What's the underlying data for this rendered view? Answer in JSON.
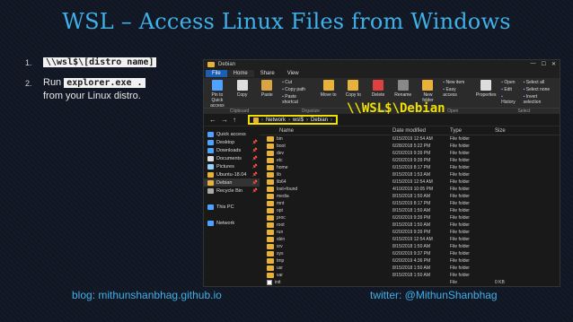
{
  "slide": {
    "title": "WSL – Access Linux Files from Windows",
    "bullets": [
      {
        "num": "1.",
        "code": "\\\\wsl$\\[distro name]"
      },
      {
        "num": "2.",
        "pre": "Run ",
        "code": "explorer.exe .",
        "post": "from your Linux distro."
      }
    ],
    "footer_left": "blog: mithunshanbhag.github.io",
    "footer_right": "twitter: @MithunShanbhag",
    "annotation": "\\\\WSL$\\Debian"
  },
  "explorer": {
    "title": "Debian",
    "tabs": [
      "File",
      "Home",
      "Share",
      "View"
    ],
    "ribbon": {
      "pin_label": "Pin to Quick access",
      "copy_label": "Copy",
      "paste_label": "Paste",
      "cut_label": "Cut",
      "copy_path_label": "Copy path",
      "paste_shortcut_label": "Paste shortcut",
      "move_label": "Move to",
      "copy_to_label": "Copy to",
      "delete_label": "Delete",
      "rename_label": "Rename",
      "new_folder_label": "New folder",
      "new_item_label": "New item",
      "easy_access_label": "Easy access",
      "properties_label": "Properties",
      "open_label": "Open",
      "edit_label": "Edit",
      "history_label": "History",
      "select_all_label": "Select all",
      "select_none_label": "Select none",
      "invert_label": "Invert selection",
      "group_labels": [
        "Clipboard",
        "Organize",
        "New",
        "Open",
        "Select"
      ]
    },
    "address": [
      "Network",
      "wsl$",
      "Debian"
    ],
    "nav": [
      {
        "label": "Quick access",
        "pin": false,
        "color": "#4da3ff"
      },
      {
        "label": "Desktop",
        "pin": true,
        "color": "#4da3ff"
      },
      {
        "label": "Downloads",
        "pin": true,
        "color": "#4da3ff"
      },
      {
        "label": "Documents",
        "pin": true,
        "color": "#dddddd"
      },
      {
        "label": "Pictures",
        "pin": true,
        "color": "#8fd1ff"
      },
      {
        "label": "Ubuntu-18.04",
        "pin": true,
        "color": "#e8b23a"
      },
      {
        "label": "Debian",
        "pin": true,
        "color": "#e8b23a"
      },
      {
        "label": "Recycle Bin",
        "pin": true,
        "color": "#aaaaaa"
      },
      {
        "label": "",
        "pin": false,
        "color": ""
      },
      {
        "label": "This PC",
        "pin": false,
        "color": "#4da3ff"
      },
      {
        "label": "",
        "pin": false,
        "color": ""
      },
      {
        "label": "Network",
        "pin": false,
        "color": "#4da3ff"
      }
    ],
    "columns": {
      "name": "Name",
      "date": "Date modified",
      "type": "Type",
      "size": "Size"
    },
    "files": [
      {
        "name": "bin",
        "date": "6/15/2019 12:54 AM",
        "type": "File folder",
        "size": ""
      },
      {
        "name": "boot",
        "date": "6/28/2018 5:22 PM",
        "type": "File folder",
        "size": ""
      },
      {
        "name": "dev",
        "date": "6/20/2019 9:39 PM",
        "type": "File folder",
        "size": ""
      },
      {
        "name": "etc",
        "date": "6/20/2019 9:39 PM",
        "type": "File folder",
        "size": ""
      },
      {
        "name": "home",
        "date": "6/15/2019 8:17 PM",
        "type": "File folder",
        "size": ""
      },
      {
        "name": "lib",
        "date": "8/15/2018 1:53 AM",
        "type": "File folder",
        "size": ""
      },
      {
        "name": "lib64",
        "date": "6/15/2019 12:54 AM",
        "type": "File folder",
        "size": ""
      },
      {
        "name": "lost+found",
        "date": "4/10/2019 10:05 PM",
        "type": "File folder",
        "size": ""
      },
      {
        "name": "media",
        "date": "8/15/2018 1:50 AM",
        "type": "File folder",
        "size": ""
      },
      {
        "name": "mnt",
        "date": "6/15/2019 8:17 PM",
        "type": "File folder",
        "size": ""
      },
      {
        "name": "opt",
        "date": "8/15/2018 1:50 AM",
        "type": "File folder",
        "size": ""
      },
      {
        "name": "proc",
        "date": "6/20/2019 9:39 PM",
        "type": "File folder",
        "size": ""
      },
      {
        "name": "root",
        "date": "8/15/2018 1:50 AM",
        "type": "File folder",
        "size": ""
      },
      {
        "name": "run",
        "date": "6/20/2019 9:39 PM",
        "type": "File folder",
        "size": ""
      },
      {
        "name": "sbin",
        "date": "6/15/2019 12:54 AM",
        "type": "File folder",
        "size": ""
      },
      {
        "name": "srv",
        "date": "8/15/2018 1:50 AM",
        "type": "File folder",
        "size": ""
      },
      {
        "name": "sys",
        "date": "6/20/2019 9:37 PM",
        "type": "File folder",
        "size": ""
      },
      {
        "name": "tmp",
        "date": "6/20/2019 4:36 PM",
        "type": "File folder",
        "size": ""
      },
      {
        "name": "usr",
        "date": "8/15/2018 1:50 AM",
        "type": "File folder",
        "size": ""
      },
      {
        "name": "var",
        "date": "8/15/2018 1:50 AM",
        "type": "File folder",
        "size": ""
      },
      {
        "name": "init",
        "date": "",
        "type": "File",
        "size": "0 KB"
      }
    ]
  }
}
